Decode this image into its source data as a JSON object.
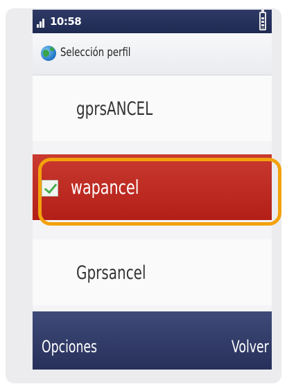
{
  "status_bar": {
    "time": "10:58",
    "signal_icon": "signal-bars-icon",
    "battery_icon": "battery-icon"
  },
  "header": {
    "icon": "globe-icon",
    "title": "Selección perfil"
  },
  "profiles": [
    {
      "label": "gprsANCEL",
      "selected": false
    },
    {
      "label": "wapancel",
      "selected": true
    },
    {
      "label": "Gprsancel",
      "selected": false
    }
  ],
  "softkeys": {
    "left": "Opciones",
    "right": "Volver"
  },
  "colors": {
    "selection": "#b31f18",
    "highlight_ring": "#f2a20d",
    "bars": "#27305a",
    "check": "#4caf50"
  }
}
